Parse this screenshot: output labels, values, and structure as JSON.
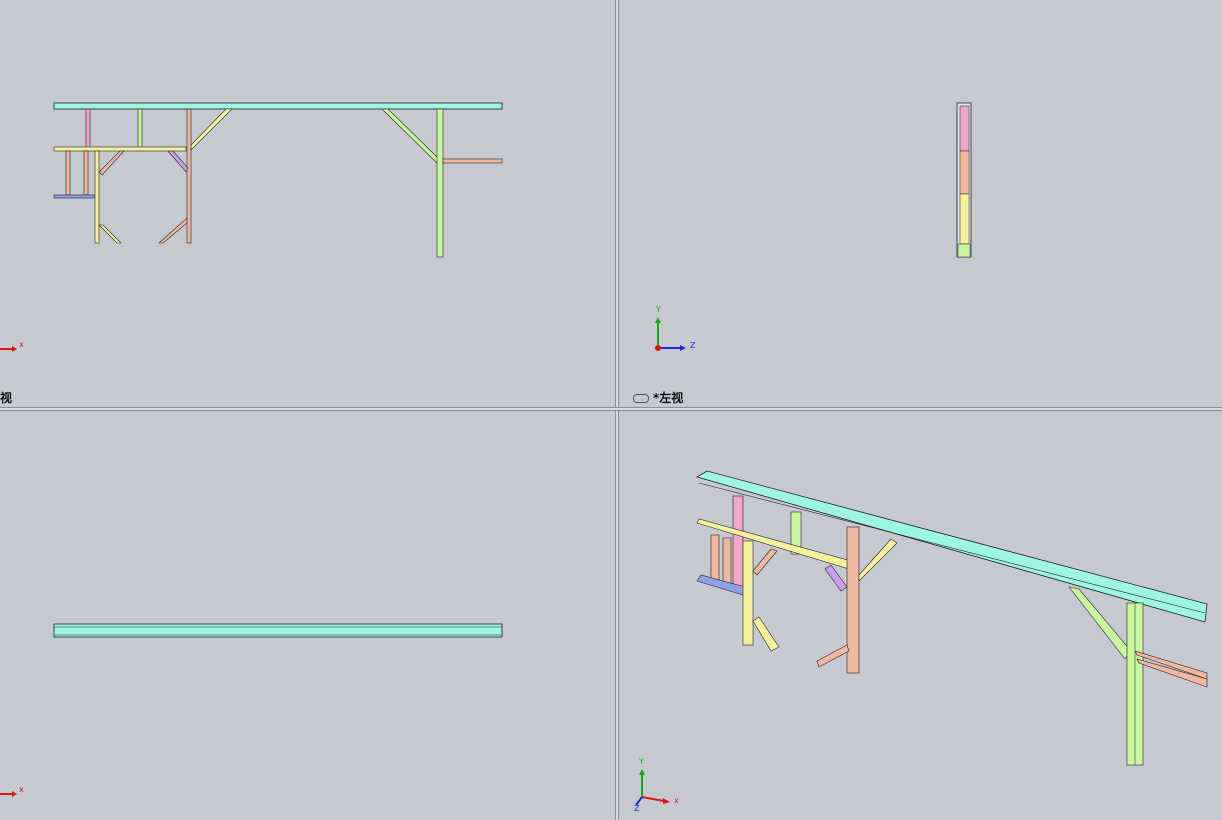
{
  "viewports": {
    "front": {
      "label": "视",
      "triad_axes": [
        "x"
      ]
    },
    "left": {
      "label": "*左视",
      "triad_axes": [
        "Y",
        "Z"
      ]
    },
    "top": {
      "label": "",
      "triad_axes": [
        "x"
      ]
    },
    "iso": {
      "label": "",
      "triad_axes": [
        "Y",
        "x",
        "Z"
      ]
    }
  },
  "toolbar": {
    "buttons": [
      "zoom-to-fit-icon",
      "zoom-area-icon",
      "previous-view-icon",
      "section-view-icon",
      "view-orientation-icon",
      "display-style-icon",
      "hide-show-icon",
      "edit-appearance-icon",
      "apply-scene-icon",
      "view-settings-icon"
    ]
  },
  "colors": {
    "viewport_bg": "#c6c9d0",
    "cyan_member": "#9ef5e4",
    "pink_member": "#f0a8c8",
    "green_member": "#c8f5a0",
    "yellow_member": "#f5f0a0",
    "salmon_member": "#f0b8a0",
    "purple_member": "#c8a0e8",
    "blue_member": "#8fa0e8",
    "axis_x": "#d81818",
    "axis_y": "#1aa81a",
    "axis_z": "#1a2ad8"
  }
}
